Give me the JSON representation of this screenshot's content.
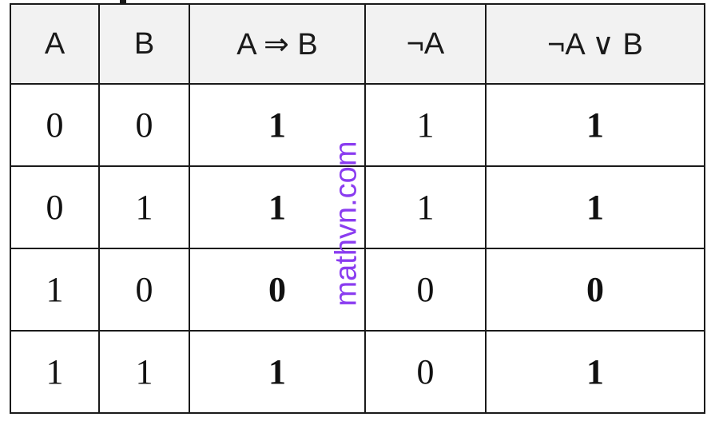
{
  "table": {
    "headers": [
      "A",
      "B",
      "A ⇒ B",
      "¬A",
      "¬A ∨ B"
    ],
    "rows": [
      [
        "0",
        "0",
        "1",
        "1",
        "1"
      ],
      [
        "0",
        "1",
        "1",
        "1",
        "1"
      ],
      [
        "1",
        "0",
        "0",
        "0",
        "0"
      ],
      [
        "1",
        "1",
        "1",
        "0",
        "1"
      ]
    ]
  },
  "watermark": "mathvn.com"
}
